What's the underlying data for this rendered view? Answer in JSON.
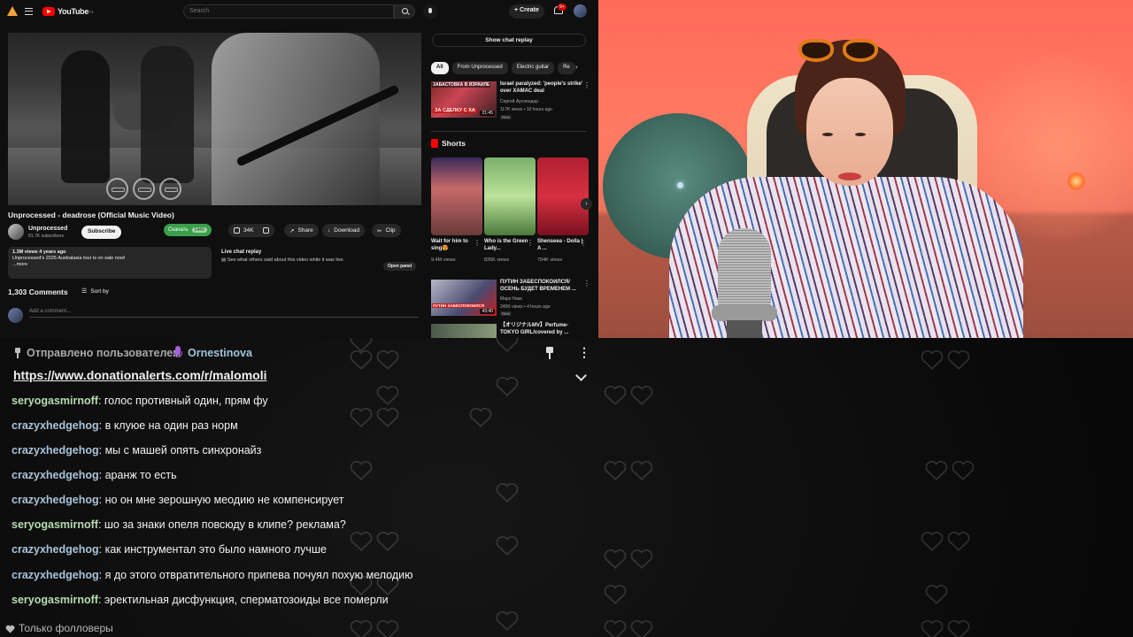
{
  "youtube": {
    "logo_text": "YouTube",
    "logo_region": "PL",
    "search_placeholder": "Search",
    "create_label": "Create",
    "notifications_badge": "9+",
    "video": {
      "title": "Unprocessed - deadrose (Official Music Video)",
      "channel_name": "Unprocessed",
      "channel_subs": "81.7K subscribers",
      "subscribe_label": "Subscribe",
      "download_ext_label": "Скачать",
      "download_ext_quality": "1440",
      "likes": "34K",
      "share_label": "Share",
      "download_label": "Download",
      "clip_label": "Clip",
      "views_meta": "1.3M views  4 years ago",
      "description": "Unprocessed's 2025 Australasia tour is on sale now!",
      "more_label": "...more",
      "live_replay_title": "Live chat replay",
      "live_replay_subtitle": "See what others said about this video while it was live.",
      "open_panel_label": "Open panel",
      "comments_count": "1,303 Comments",
      "sort_label": "Sort by",
      "add_comment_placeholder": "Add a comment..."
    },
    "sidebar": {
      "show_chat_label": "Show chat replay",
      "chips": [
        "All",
        "From Unprocessed",
        "Electric guitar",
        "Re"
      ],
      "rec1": {
        "thumb_text_top": "ЗАБАСТОВКА В ИЗРАИЛЕ",
        "thumb_text_bottom": "ЗА СДЕЛКУ С ХА",
        "duration": "21:45",
        "title": "Israel paralyzed: 'people's strike' over ХАМАС deal",
        "channel": "Сергей Ауслендер",
        "meta": "117K views • 10 hours ago",
        "new": "New"
      },
      "shorts_label": "Shorts",
      "shorts": [
        {
          "title": "Wait for him to sing😍",
          "views": "9.4M views"
        },
        {
          "title": "Who is the Green Lady...",
          "views": "835K views"
        },
        {
          "title": "Shenseea - Dolla | A ...",
          "views": "794K views"
        }
      ],
      "rec2": {
        "thumb_text": "ПУТИН ЗАБЕСПОКОИЛСЯ",
        "duration": "43:40",
        "title": "ПУТИН ЗАБЕСПОКОИЛСЯ/ ОСЕНЬ БУДЕТ ВРЕМЕНЕМ ...",
        "channel": "Марк Наки",
        "meta": "245K views • 4 hours ago",
        "new": "New"
      },
      "rec3": {
        "title": "【オリジナルMV】Perfume- TOKYO GIRL/covered by ..."
      }
    }
  },
  "pinned": {
    "sender_label": "Отправлено пользователем",
    "sender_name": "Ornestinova",
    "link": "https://www.donationalerts.com/r/malomoli"
  },
  "chat": {
    "colors": {
      "seryo": "#b5dcb0",
      "crazy": "#a9c3d9"
    },
    "messages": [
      {
        "user": "seryogasmirnoff",
        "text": ": голос противный один, прям фу"
      },
      {
        "user": "crazyxhedgehog",
        "text": ": в клуюе на один раз норм"
      },
      {
        "user": "crazyxhedgehog",
        "text": ": мы с машей опять синхронайз"
      },
      {
        "user": "crazyxhedgehog",
        "text": ": аранж то есть"
      },
      {
        "user": "crazyxhedgehog",
        "text": ": но он мне зерошную меодию не компенсирует"
      },
      {
        "user": "seryogasmirnoff",
        "text": ": шо за знаки опеля повсюду в клипе? реклама?"
      },
      {
        "user": "crazyxhedgehog",
        "text": ": как инструментал это было намного лучше"
      },
      {
        "user": "crazyxhedgehog",
        "text": ": я до этого отвратительного припева почуял похую мелодию"
      },
      {
        "user": "seryogasmirnoff",
        "text": ": эректильная дисфункция, сперматозоиды все померли"
      }
    ],
    "followers_only": "Только фолловеры"
  }
}
